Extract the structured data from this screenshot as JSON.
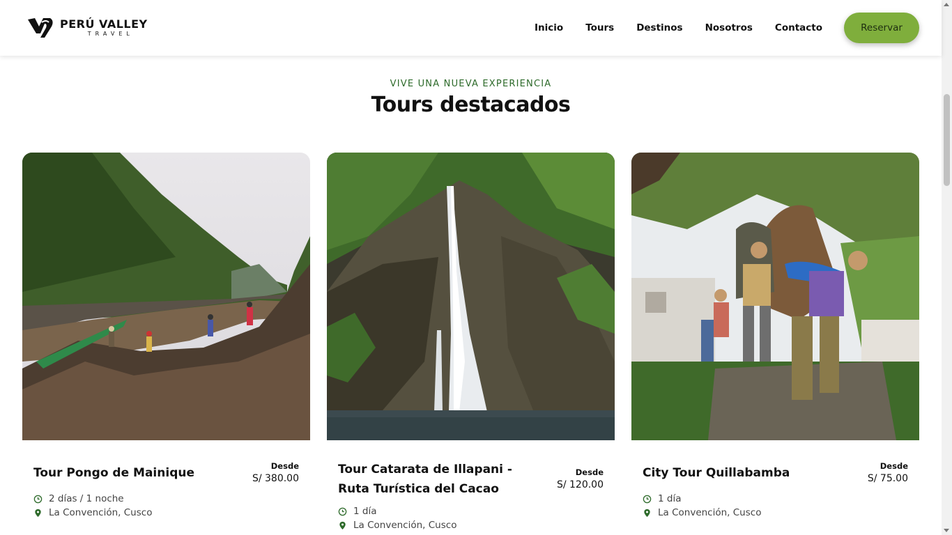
{
  "brand": {
    "name": "PERÚ VALLEY",
    "sub": "TRAVEL"
  },
  "nav": {
    "items": [
      "Inicio",
      "Tours",
      "Destinos",
      "Nosotros",
      "Contacto"
    ],
    "cta": "Reservar"
  },
  "colors": {
    "accent": "#7fae3c",
    "eyebrow": "#2d6a2a",
    "icon": "#2d6a2a"
  },
  "section": {
    "eyebrow": "VIVE UNA NUEVA EXPERIENCIA",
    "title": "Tours destacados"
  },
  "tours": [
    {
      "title": "Tour Pongo de Mainique",
      "price_label": "Desde",
      "price": "S/ 380.00",
      "duration": "2 días / 1 noche",
      "location": "La Convención, Cusco"
    },
    {
      "title": "Tour Catarata de Illapani - Ruta Turística del Cacao",
      "price_label": "Desde",
      "price": "S/ 120.00",
      "duration": "1 día",
      "location": "La Convención, Cusco"
    },
    {
      "title": "City Tour Quillabamba",
      "price_label": "Desde",
      "price": "S/ 75.00",
      "duration": "1 día",
      "location": "La Convención, Cusco"
    }
  ]
}
